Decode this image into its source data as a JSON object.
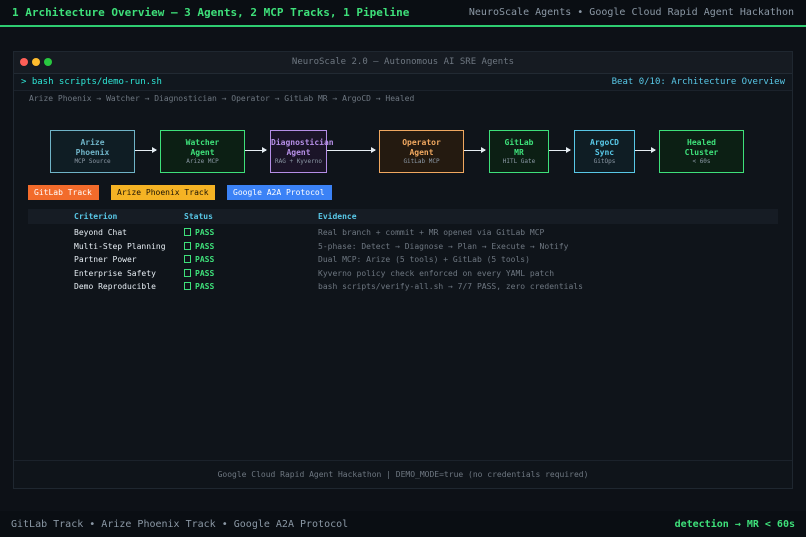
{
  "topbar": {
    "title": "1  Architecture Overview — 3 Agents, 2 MCP Tracks, 1 Pipeline",
    "right": "NeuroScale Agents  •  Google Cloud Rapid Agent Hackathon"
  },
  "window": {
    "title": "NeuroScale 2.0  —  Autonomous AI SRE Agents",
    "command": "> bash scripts/demo-run.sh",
    "beat": "Beat 0/10: Architecture Overview",
    "flow_summary": "Arize Phoenix → Watcher → Diagnostician → Operator → GitLab MR → ArgoCD → Healed",
    "colors": {
      "accent_green": "#3ee07a",
      "accent_cyan": "#58c7e6"
    }
  },
  "pipeline": [
    {
      "line1": "Arize",
      "line2": "Phoenix",
      "sub": "MCP Source",
      "color": "#6fb3c7",
      "bg": "#0f1d24"
    },
    {
      "line1": "Watcher",
      "line2": "Agent",
      "sub": "Arize MCP",
      "color": "#3ee07a",
      "bg": "#0c1f14"
    },
    {
      "line1": "Diagnostician",
      "line2": "Agent",
      "sub": "RAG + Kyverno",
      "color": "#b58ee6",
      "bg": "#1b1428"
    },
    {
      "line1": "Operator",
      "line2": "Agent",
      "sub": "GitLab MCP",
      "color": "#f0a860",
      "bg": "#241a10"
    },
    {
      "line1": "GitLab",
      "line2": "MR",
      "sub": "HITL Gate",
      "color": "#3ee07a",
      "bg": "#0c1f14"
    },
    {
      "line1": "ArgoCD",
      "line2": "Sync",
      "sub": "GitOps",
      "color": "#58c7e6",
      "bg": "#0f1d24"
    },
    {
      "line1": "Healed",
      "line2": "Cluster",
      "sub": "< 60s",
      "color": "#3ee07a",
      "bg": "#0c1f14"
    }
  ],
  "tracks": [
    {
      "label": "GitLab Track",
      "color": "#f26b2b"
    },
    {
      "label": "Arize Phoenix Track",
      "color": "#f5b324"
    },
    {
      "label": "Google A2A Protocol",
      "color": "#3b82f6"
    }
  ],
  "table": {
    "headers": {
      "criterion": "Criterion",
      "status": "Status",
      "evidence": "Evidence"
    },
    "rows": [
      {
        "criterion": "Beyond Chat",
        "status": "PASS",
        "evidence": "Real branch + commit + MR opened via GitLab MCP"
      },
      {
        "criterion": "Multi-Step Planning",
        "status": "PASS",
        "evidence": "5-phase: Detect → Diagnose → Plan → Execute → Notify"
      },
      {
        "criterion": "Partner Power",
        "status": "PASS",
        "evidence": "Dual MCP: Arize (5 tools) + GitLab (5 tools)"
      },
      {
        "criterion": "Enterprise Safety",
        "status": "PASS",
        "evidence": "Kyverno policy check enforced on every YAML patch"
      },
      {
        "criterion": "Demo Reproducible",
        "status": "PASS",
        "evidence": "bash scripts/verify-all.sh → 7/7 PASS, zero credentials"
      }
    ]
  },
  "window_footer": "Google Cloud Rapid Agent Hackathon  |  DEMO_MODE=true (no credentials required)",
  "bottombar": {
    "left": "GitLab Track  •  Arize Phoenix Track  •  Google A2A Protocol",
    "right": "detection → MR  <  60s"
  }
}
